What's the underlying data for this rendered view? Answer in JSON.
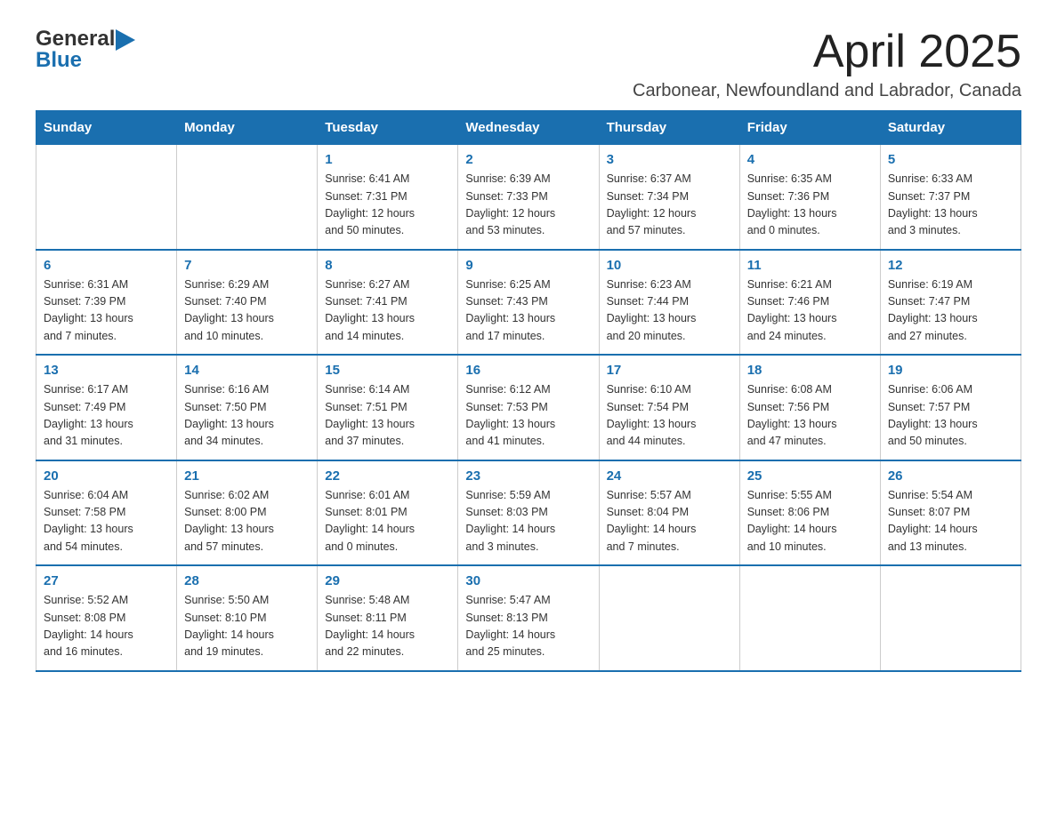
{
  "header": {
    "logo_general": "General",
    "logo_blue": "Blue",
    "month_title": "April 2025",
    "location": "Carbonear, Newfoundland and Labrador, Canada"
  },
  "calendar": {
    "days_of_week": [
      "Sunday",
      "Monday",
      "Tuesday",
      "Wednesday",
      "Thursday",
      "Friday",
      "Saturday"
    ],
    "weeks": [
      [
        {
          "day": "",
          "details": ""
        },
        {
          "day": "",
          "details": ""
        },
        {
          "day": "1",
          "details": "Sunrise: 6:41 AM\nSunset: 7:31 PM\nDaylight: 12 hours\nand 50 minutes."
        },
        {
          "day": "2",
          "details": "Sunrise: 6:39 AM\nSunset: 7:33 PM\nDaylight: 12 hours\nand 53 minutes."
        },
        {
          "day": "3",
          "details": "Sunrise: 6:37 AM\nSunset: 7:34 PM\nDaylight: 12 hours\nand 57 minutes."
        },
        {
          "day": "4",
          "details": "Sunrise: 6:35 AM\nSunset: 7:36 PM\nDaylight: 13 hours\nand 0 minutes."
        },
        {
          "day": "5",
          "details": "Sunrise: 6:33 AM\nSunset: 7:37 PM\nDaylight: 13 hours\nand 3 minutes."
        }
      ],
      [
        {
          "day": "6",
          "details": "Sunrise: 6:31 AM\nSunset: 7:39 PM\nDaylight: 13 hours\nand 7 minutes."
        },
        {
          "day": "7",
          "details": "Sunrise: 6:29 AM\nSunset: 7:40 PM\nDaylight: 13 hours\nand 10 minutes."
        },
        {
          "day": "8",
          "details": "Sunrise: 6:27 AM\nSunset: 7:41 PM\nDaylight: 13 hours\nand 14 minutes."
        },
        {
          "day": "9",
          "details": "Sunrise: 6:25 AM\nSunset: 7:43 PM\nDaylight: 13 hours\nand 17 minutes."
        },
        {
          "day": "10",
          "details": "Sunrise: 6:23 AM\nSunset: 7:44 PM\nDaylight: 13 hours\nand 20 minutes."
        },
        {
          "day": "11",
          "details": "Sunrise: 6:21 AM\nSunset: 7:46 PM\nDaylight: 13 hours\nand 24 minutes."
        },
        {
          "day": "12",
          "details": "Sunrise: 6:19 AM\nSunset: 7:47 PM\nDaylight: 13 hours\nand 27 minutes."
        }
      ],
      [
        {
          "day": "13",
          "details": "Sunrise: 6:17 AM\nSunset: 7:49 PM\nDaylight: 13 hours\nand 31 minutes."
        },
        {
          "day": "14",
          "details": "Sunrise: 6:16 AM\nSunset: 7:50 PM\nDaylight: 13 hours\nand 34 minutes."
        },
        {
          "day": "15",
          "details": "Sunrise: 6:14 AM\nSunset: 7:51 PM\nDaylight: 13 hours\nand 37 minutes."
        },
        {
          "day": "16",
          "details": "Sunrise: 6:12 AM\nSunset: 7:53 PM\nDaylight: 13 hours\nand 41 minutes."
        },
        {
          "day": "17",
          "details": "Sunrise: 6:10 AM\nSunset: 7:54 PM\nDaylight: 13 hours\nand 44 minutes."
        },
        {
          "day": "18",
          "details": "Sunrise: 6:08 AM\nSunset: 7:56 PM\nDaylight: 13 hours\nand 47 minutes."
        },
        {
          "day": "19",
          "details": "Sunrise: 6:06 AM\nSunset: 7:57 PM\nDaylight: 13 hours\nand 50 minutes."
        }
      ],
      [
        {
          "day": "20",
          "details": "Sunrise: 6:04 AM\nSunset: 7:58 PM\nDaylight: 13 hours\nand 54 minutes."
        },
        {
          "day": "21",
          "details": "Sunrise: 6:02 AM\nSunset: 8:00 PM\nDaylight: 13 hours\nand 57 minutes."
        },
        {
          "day": "22",
          "details": "Sunrise: 6:01 AM\nSunset: 8:01 PM\nDaylight: 14 hours\nand 0 minutes."
        },
        {
          "day": "23",
          "details": "Sunrise: 5:59 AM\nSunset: 8:03 PM\nDaylight: 14 hours\nand 3 minutes."
        },
        {
          "day": "24",
          "details": "Sunrise: 5:57 AM\nSunset: 8:04 PM\nDaylight: 14 hours\nand 7 minutes."
        },
        {
          "day": "25",
          "details": "Sunrise: 5:55 AM\nSunset: 8:06 PM\nDaylight: 14 hours\nand 10 minutes."
        },
        {
          "day": "26",
          "details": "Sunrise: 5:54 AM\nSunset: 8:07 PM\nDaylight: 14 hours\nand 13 minutes."
        }
      ],
      [
        {
          "day": "27",
          "details": "Sunrise: 5:52 AM\nSunset: 8:08 PM\nDaylight: 14 hours\nand 16 minutes."
        },
        {
          "day": "28",
          "details": "Sunrise: 5:50 AM\nSunset: 8:10 PM\nDaylight: 14 hours\nand 19 minutes."
        },
        {
          "day": "29",
          "details": "Sunrise: 5:48 AM\nSunset: 8:11 PM\nDaylight: 14 hours\nand 22 minutes."
        },
        {
          "day": "30",
          "details": "Sunrise: 5:47 AM\nSunset: 8:13 PM\nDaylight: 14 hours\nand 25 minutes."
        },
        {
          "day": "",
          "details": ""
        },
        {
          "day": "",
          "details": ""
        },
        {
          "day": "",
          "details": ""
        }
      ]
    ]
  }
}
